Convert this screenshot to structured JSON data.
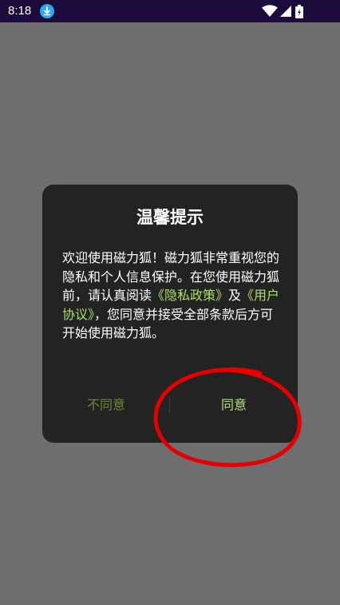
{
  "status_bar": {
    "time": "8:18",
    "icons": [
      "download-icon",
      "wifi-icon",
      "signal-icon",
      "battery-icon"
    ]
  },
  "dialog": {
    "title": "温馨提示",
    "body": {
      "text_1": "欢迎使用磁力狐！磁力狐非常重视您的隐私和个人信息保护。在您使用磁力狐前，请认真阅读",
      "privacy_link": "《隐私政策》",
      "and": "及",
      "agreement_link": "《用户协议》",
      "text_2": "，您同意并接受全部条款后方可开始使用磁力狐。"
    },
    "disagree_label": "不同意",
    "agree_label": "同意"
  },
  "colors": {
    "status_bar": "#1d0b3d",
    "scrim": "#6e6e6e",
    "dialog_bg": "#232323",
    "link": "#a8e06a",
    "agree": "#b5e07a",
    "disagree": "#6a8a3c",
    "annotation": "#e60000"
  }
}
